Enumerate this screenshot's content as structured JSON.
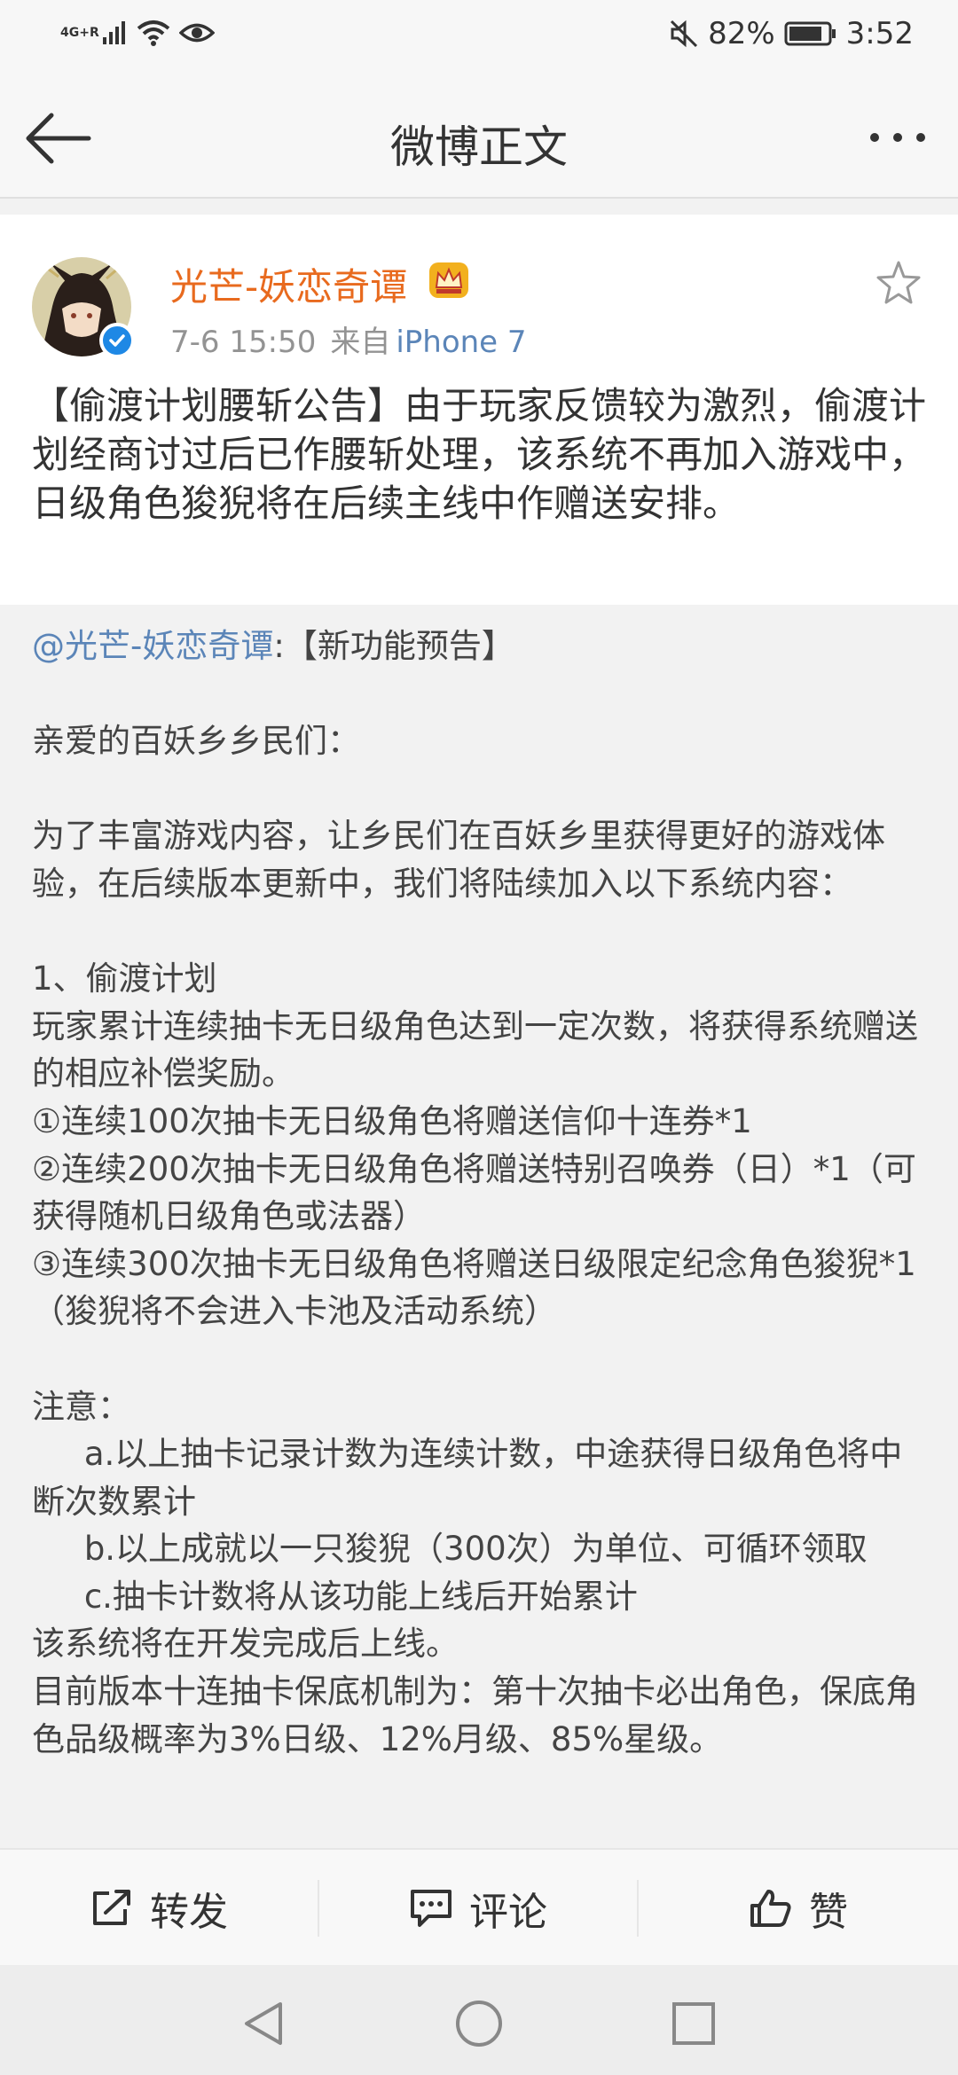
{
  "status_bar": {
    "network": "4G+R",
    "battery": "82%",
    "time": "3:52",
    "icons": [
      "signal-icon",
      "wifi-icon",
      "eye-icon",
      "mute-icon",
      "battery-icon"
    ]
  },
  "header": {
    "title": "微博正文",
    "icons": [
      "back-arrow-icon",
      "more-dots-icon"
    ]
  },
  "post": {
    "author": "光芒-妖恋奇谭",
    "time": "7-6 15:50",
    "source_prefix": "来自",
    "source_device": "iPhone 7",
    "text": "【偷渡计划腰斩公告】由于玩家反馈较为激烈，偷渡计划经商讨过后已作腰斩处理，该系统不再加入游戏中，日级角色狻猊将在后续主线中作赠送安排。"
  },
  "retweet": {
    "mention": "@光芒-妖恋奇谭",
    "title_rest": ":【新功能预告】",
    "body": "\n亲爱的百妖乡乡民们：\n\n为了丰富游戏内容，让乡民们在百妖乡里获得更好的游戏体验，在后续版本更新中，我们将陆续加入以下系统内容：\n\n1、偷渡计划\n玩家累计连续抽卡无日级角色达到一定次数，将获得系统赠送的相应补偿奖励。\n①连续100次抽卡无日级角色将赠送信仰十连券*1\n②连续200次抽卡无日级角色将赠送特别召唤券（日）*1（可获得随机日级角色或法器）\n③连续300次抽卡无日级角色将赠送日级限定纪念角色狻猊*1（狻猊将不会进入卡池及活动系统）\n\n注意：\n     a.以上抽卡记录计数为连续计数，中途获得日级角色将中断次数累计\n     b.以上成就以一只狻猊（300次）为单位、可循环领取\n     c.抽卡计数将从该功能上线后开始累计\n该系统将在开发完成后上线。\n目前版本十连抽卡保底机制为：第十次抽卡必出角色，保底角色品级概率为3%日级、12%月级、85%星级。"
  },
  "actions": {
    "repost": "转发",
    "comment": "评论",
    "like": "赞"
  },
  "colors": {
    "author": "#e86a1e",
    "link": "#5b85b8",
    "verified": "#1e88e5",
    "crown": "#f2b01e"
  }
}
